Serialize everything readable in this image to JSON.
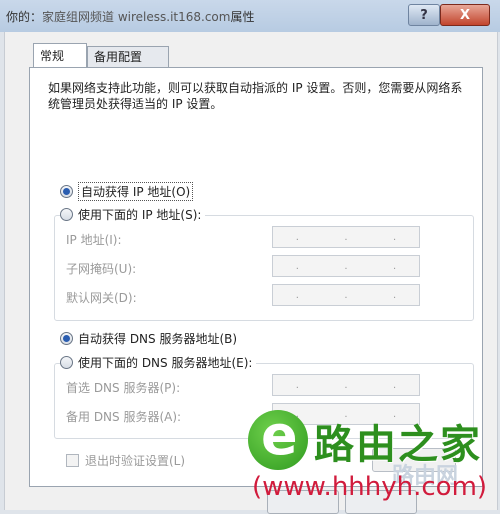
{
  "titlebar": {
    "prefix": "你的：",
    "site": "家庭组网频道 wireless.it168.com",
    "suffix": "属性",
    "help_label": "?",
    "close_label": "X"
  },
  "tabs": [
    {
      "label": "常规",
      "active": true
    },
    {
      "label": "备用配置",
      "active": false
    }
  ],
  "description": "如果网络支持此功能，则可以获取自动指派的 IP 设置。否则，您需要从网络系统管理员处获得适当的 IP 设置。",
  "ip": {
    "auto_label": "自动获得 IP 地址(O)",
    "auto_selected": true,
    "manual_label": "使用下面的 IP 地址(S):",
    "fields": [
      {
        "label": "IP 地址(I):"
      },
      {
        "label": "子网掩码(U):"
      },
      {
        "label": "默认网关(D):"
      }
    ]
  },
  "dns": {
    "auto_label": "自动获得 DNS 服务器地址(B)",
    "auto_selected": true,
    "manual_label": "使用下面的 DNS 服务器地址(E):",
    "fields": [
      {
        "label": "首选 DNS 服务器(P):"
      },
      {
        "label": "备用 DNS 服务器(A):"
      }
    ]
  },
  "validate_label": "退出时验证设置(L)",
  "watermark": {
    "name": "路由之家",
    "url": "(www.hhhyh.com)",
    "ghost": "路由网"
  },
  "colors": {
    "selected_radio": "#2a5db0",
    "watermark_green": "#2d8f1e",
    "watermark_red": "#d11b3c"
  }
}
